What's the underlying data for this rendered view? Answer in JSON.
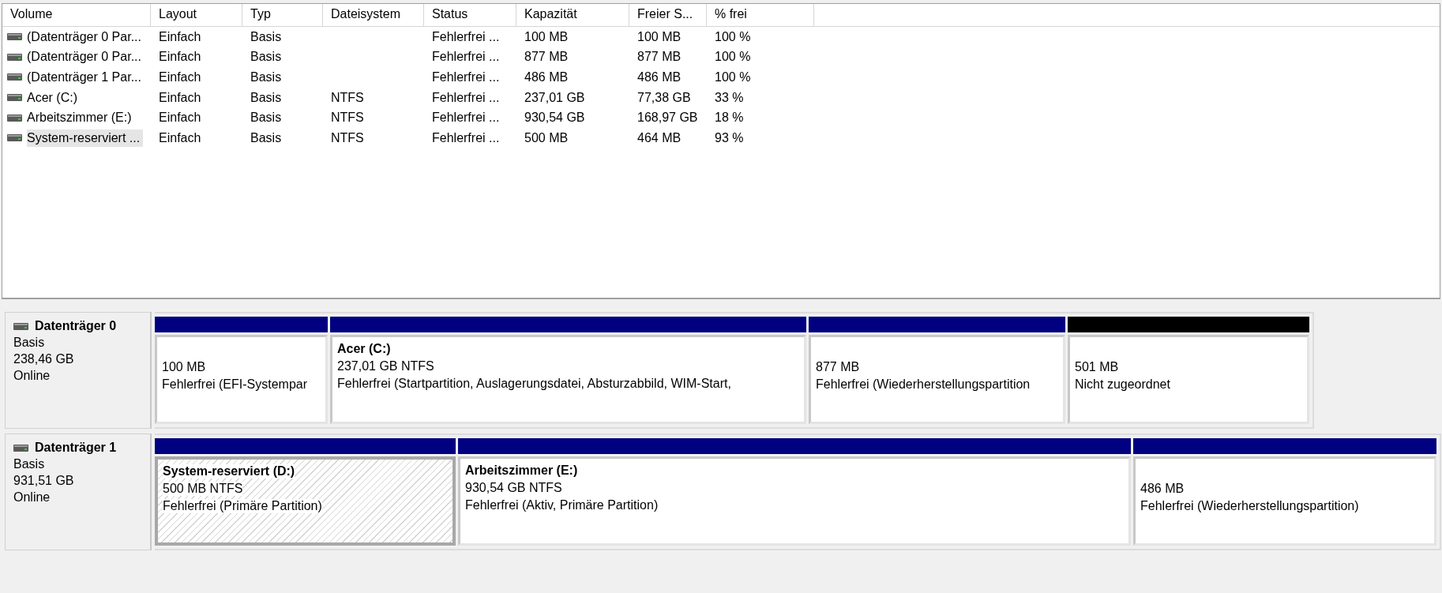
{
  "volume_table": {
    "columns": [
      "Volume",
      "Layout",
      "Typ",
      "Dateisystem",
      "Status",
      "Kapazität",
      "Freier S...",
      "% frei"
    ],
    "rows": [
      {
        "cells": [
          "(Datenträger 0 Par...",
          "Einfach",
          "Basis",
          "",
          "Fehlerfrei ...",
          "100 MB",
          "100 MB",
          "100 %"
        ],
        "selected": false
      },
      {
        "cells": [
          "(Datenträger 0 Par...",
          "Einfach",
          "Basis",
          "",
          "Fehlerfrei ...",
          "877 MB",
          "877 MB",
          "100 %"
        ],
        "selected": false
      },
      {
        "cells": [
          "(Datenträger 1 Par...",
          "Einfach",
          "Basis",
          "",
          "Fehlerfrei ...",
          "486 MB",
          "486 MB",
          "100 %"
        ],
        "selected": false
      },
      {
        "cells": [
          "Acer (C:)",
          "Einfach",
          "Basis",
          "NTFS",
          "Fehlerfrei ...",
          "237,01 GB",
          "77,38 GB",
          "33 %"
        ],
        "selected": false
      },
      {
        "cells": [
          "Arbeitszimmer (E:)",
          "Einfach",
          "Basis",
          "NTFS",
          "Fehlerfrei ...",
          "930,54 GB",
          "168,97 GB",
          "18 %"
        ],
        "selected": false
      },
      {
        "cells": [
          "System-reserviert ...",
          "Einfach",
          "Basis",
          "NTFS",
          "Fehlerfrei ...",
          "500 MB",
          "464 MB",
          "93 %"
        ],
        "selected": true
      }
    ]
  },
  "disks": [
    {
      "name": "Datenträger 0",
      "type": "Basis",
      "size": "238,46 GB",
      "state": "Online",
      "partitions": [
        {
          "kind": "primary",
          "selected": false,
          "size": "100 MB",
          "status": "Fehlerfrei (EFI-Systempar"
        },
        {
          "kind": "primary",
          "selected": false,
          "title": "Acer  (C:)",
          "size": "237,01 GB NTFS",
          "status": "Fehlerfrei (Startpartition, Auslagerungsdatei, Absturzabbild, WIM-Start,"
        },
        {
          "kind": "primary",
          "selected": false,
          "size": "877 MB",
          "status": "Fehlerfrei (Wiederherstellungspartition"
        },
        {
          "kind": "unallocated",
          "selected": false,
          "size": "501 MB",
          "status": "Nicht zugeordnet"
        }
      ]
    },
    {
      "name": "Datenträger 1",
      "type": "Basis",
      "size": "931,51 GB",
      "state": "Online",
      "partitions": [
        {
          "kind": "primary",
          "selected": true,
          "title": "System-reserviert  (D:)",
          "size": "500 MB NTFS",
          "status": "Fehlerfrei (Primäre Partition)"
        },
        {
          "kind": "primary",
          "selected": false,
          "title": "Arbeitszimmer  (E:)",
          "size": "930,54 GB NTFS",
          "status": "Fehlerfrei (Aktiv, Primäre Partition)"
        },
        {
          "kind": "primary",
          "selected": false,
          "size": "486 MB",
          "status": "Fehlerfrei (Wiederherstellungspartition)"
        }
      ]
    }
  ]
}
